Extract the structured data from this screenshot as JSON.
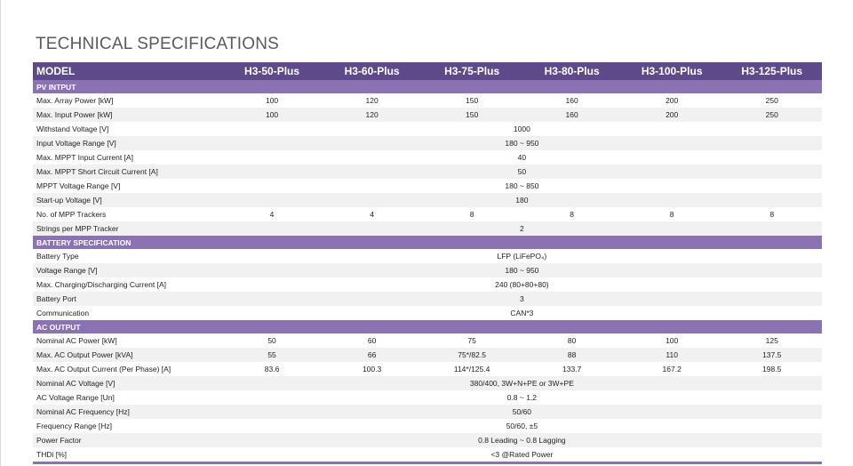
{
  "title": "TECHNICAL SPECIFICATIONS",
  "models_label": "MODEL",
  "models": [
    "H3-50-Plus",
    "H3-60-Plus",
    "H3-75-Plus",
    "H3-80-Plus",
    "H3-100-Plus",
    "H3-125-Plus"
  ],
  "colors": {
    "header": "#5e4a8a",
    "section": "#8b72b3",
    "shade": "#f1f1f1"
  },
  "sections": [
    {
      "name": "PV INTPUT",
      "rows": [
        {
          "label": "Max. Array Power [kW]",
          "values": [
            "100",
            "120",
            "150",
            "160",
            "200",
            "250"
          ]
        },
        {
          "label": "Max. Input Power [kW]",
          "values": [
            "100",
            "120",
            "150",
            "160",
            "200",
            "250"
          ]
        },
        {
          "label": "Withstand Voltage [V]",
          "value": "1000"
        },
        {
          "label": "Input Voltage Range [V]",
          "value": "180 ~ 950"
        },
        {
          "label": "Max. MPPT Input Current [A]",
          "value": "40"
        },
        {
          "label": "Max. MPPT Short Circuit Current [A]",
          "value": "50"
        },
        {
          "label": "MPPT Voltage Range [V]",
          "value": "180 ~ 850"
        },
        {
          "label": "Start-up Voltage [V]",
          "value": "180"
        },
        {
          "label": "No. of MPP Trackers",
          "values": [
            "4",
            "4",
            "8",
            "8",
            "8",
            "8"
          ]
        },
        {
          "label": "Strings per MPP Tracker",
          "value": "2"
        }
      ]
    },
    {
      "name": "BATTERY SPECIFICATION",
      "rows": [
        {
          "label": "Battery Type",
          "value": "LFP (LiFePO₄)"
        },
        {
          "label": "Voltage Range [V]",
          "value": "180 ~ 950"
        },
        {
          "label": "Max. Charging/Discharging Current [A]",
          "value": "240 (80+80+80)"
        },
        {
          "label": "Battery Port",
          "value": "3"
        },
        {
          "label": "Communication",
          "value": "CAN*3"
        }
      ]
    },
    {
      "name": "AC OUTPUT",
      "rows": [
        {
          "label": "Nominal AC Power [kW]",
          "values": [
            "50",
            "60",
            "75",
            "80",
            "100",
            "125"
          ]
        },
        {
          "label": "Max. AC Output Power [kVA]",
          "values": [
            "55",
            "66",
            "75*/82.5",
            "88",
            "110",
            "137.5"
          ]
        },
        {
          "label": "Max. AC Output Current (Per Phase) [A]",
          "values": [
            "83.6",
            "100.3",
            "114*/125.4",
            "133.7",
            "167.2",
            "198.5"
          ]
        },
        {
          "label": "Nominal AC Voltage [V]",
          "value": "380/400, 3W+N+PE or 3W+PE"
        },
        {
          "label": "AC Voltage Range [Un]",
          "value": "0.8 ~ 1.2"
        },
        {
          "label": "Nominal AC Frequency [Hz]",
          "value": "50/60"
        },
        {
          "label": "Frequency Range [Hz]",
          "value": "50/60, ±5"
        },
        {
          "label": "Power Factor",
          "value": "0.8 Leading ~ 0.8 Lagging"
        },
        {
          "label": "THDi [%]",
          "value": "<3 @Rated Power"
        }
      ]
    }
  ]
}
